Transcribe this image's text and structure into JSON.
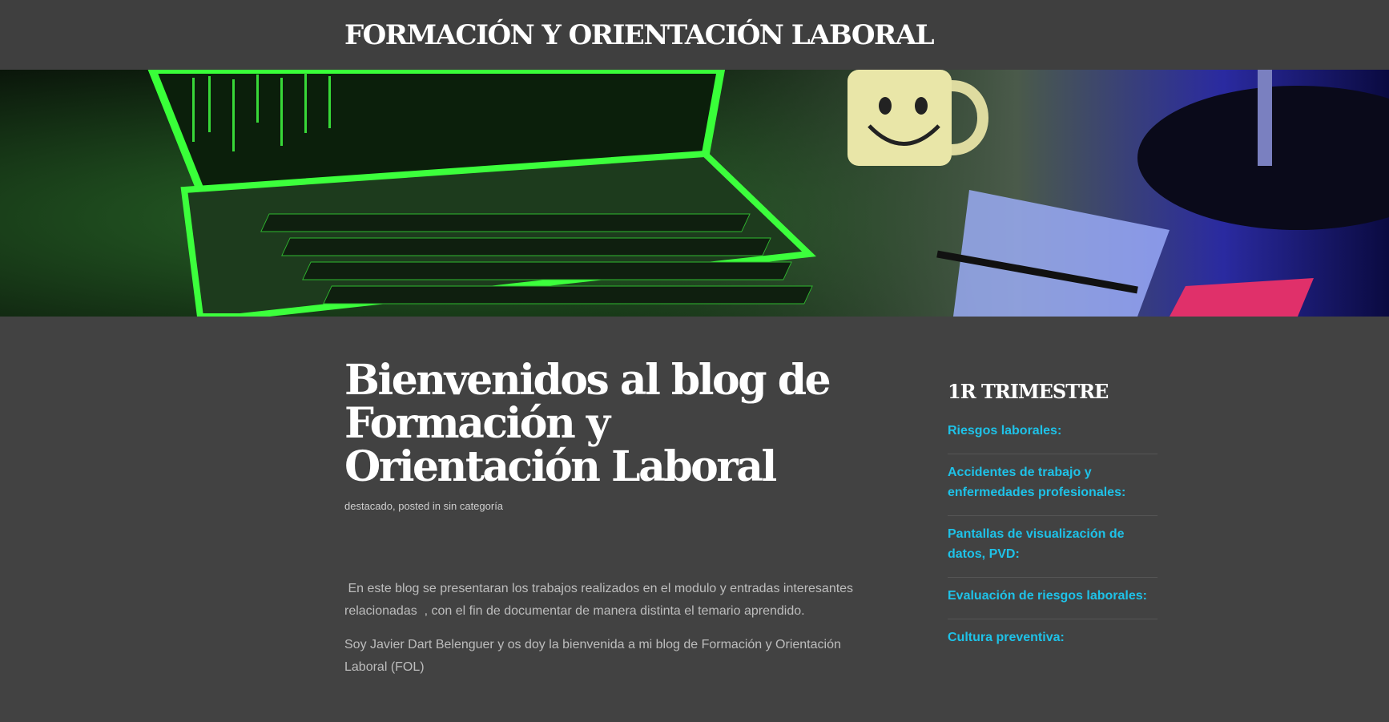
{
  "header": {
    "site_title": "FORMACIÓN Y ORIENTACIÓN LABORAL"
  },
  "hero": {
    "description": ""
  },
  "post": {
    "title": "Bienvenidos al blog de Formación y Orientación Laboral",
    "meta": {
      "tag": "destacado",
      "separator": ", posted in ",
      "category": "sin categoría"
    },
    "paragraphs": [
      " En este blog se presentaran los trabajos realizados en el modulo y entradas interesantes relacionadas  , con el fin de documentar de manera distinta el temario aprendido.",
      "Soy Javier Dart Belenguer y os doy la bienvenida a mi blog de Formación y Orientación Laboral (FOL)"
    ]
  },
  "sidebar": {
    "title": "1R TRIMESTRE",
    "links": [
      "Riesgos laborales:",
      "Accidentes de trabajo y enfermedades profesionales:",
      "Pantallas de visualización de datos, PVD:",
      "Evaluación de riesgos laborales:",
      "Cultura preventiva:"
    ]
  },
  "colors": {
    "background": "#424242",
    "header": "#3f3f3f",
    "link": "#1ec2e8"
  }
}
